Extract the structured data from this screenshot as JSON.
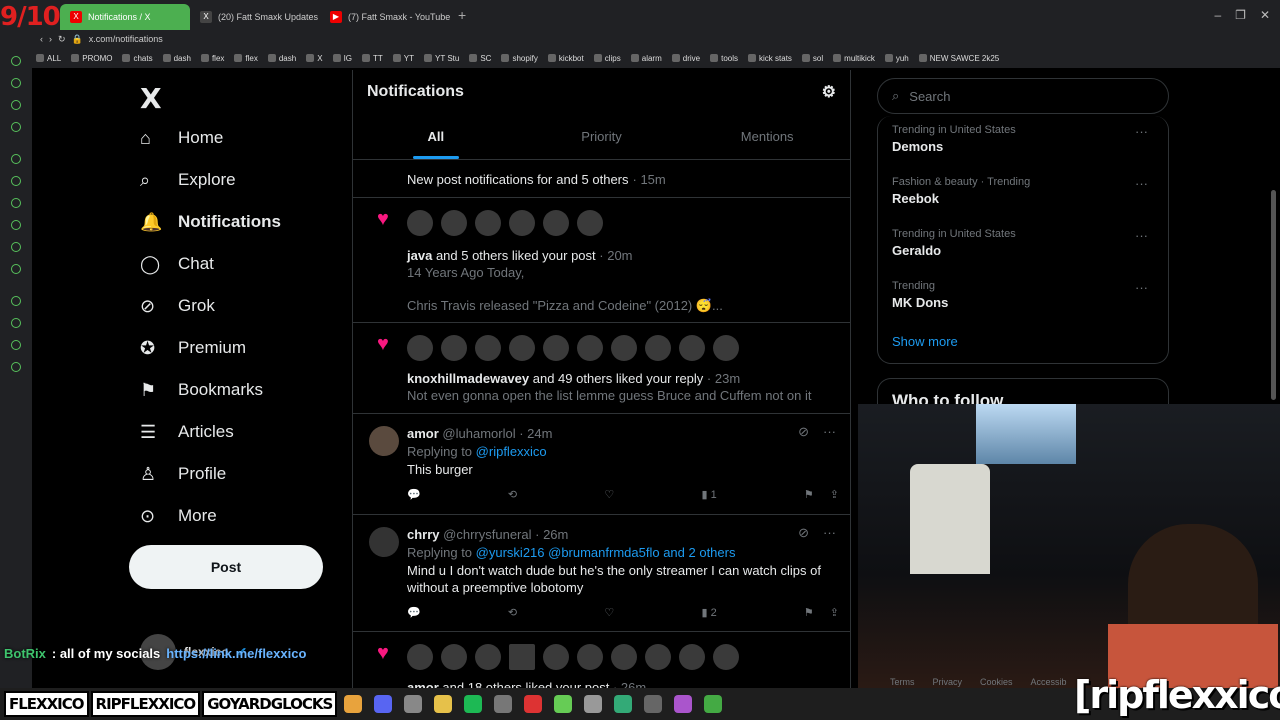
{
  "overlay": {
    "score": "9/10",
    "chat_bot": "BotRix",
    "chat_msg": ": all of my socials",
    "chat_link": "https://link.me/flexxico",
    "watermark": "[ripflexxico]"
  },
  "browser": {
    "tabs": [
      {
        "label": "Notifications / X",
        "active": true
      },
      {
        "label": "(20) Fatt Smaxk Updates (",
        "active": false
      },
      {
        "label": "(7) Fatt Smaxk - YouTube",
        "active": false
      }
    ],
    "url": "x.com/notifications",
    "bookmarks": [
      "ALL",
      "PROMO",
      "chats",
      "dash",
      "flex",
      "flex",
      "dash",
      "X",
      "IG",
      "TT",
      "YT",
      "YT Stu",
      "SC",
      "shopify",
      "kickbot",
      "clips",
      "alarm",
      "drive",
      "tools",
      "kick stats",
      "sol",
      "multikick",
      "yuh",
      "NEW SAWCE 2k25"
    ]
  },
  "nav": {
    "logo": "X",
    "items": [
      {
        "label": "Home",
        "icon": "home-icon"
      },
      {
        "label": "Explore",
        "icon": "search-icon"
      },
      {
        "label": "Notifications",
        "icon": "bell-icon"
      },
      {
        "label": "Chat",
        "icon": "chat-icon"
      },
      {
        "label": "Grok",
        "icon": "grok-icon"
      },
      {
        "label": "Premium",
        "icon": "premium-icon"
      },
      {
        "label": "Bookmarks",
        "icon": "bookmark-icon"
      },
      {
        "label": "Articles",
        "icon": "articles-icon"
      },
      {
        "label": "Profile",
        "icon": "profile-icon"
      },
      {
        "label": "More",
        "icon": "more-icon"
      }
    ],
    "post_label": "Post",
    "user_name": "flexxico"
  },
  "main": {
    "title": "Notifications",
    "tabs": [
      "All",
      "Priority",
      "Mentions"
    ],
    "n1": {
      "text": "New post notifications for",
      "suffix": "and 5 others",
      "time": "· 15m"
    },
    "n2": {
      "user": "java",
      "text": "and 5 others liked your post",
      "time": "· 20m",
      "line1": "14 Years Ago Today,",
      "line2": "Chris Travis released \"Pizza and Codeine\" (2012) 😴..."
    },
    "n3": {
      "user": "knoxhillmadewavey",
      "text": "and 49 others liked your reply",
      "time": "· 23m",
      "line1": "Not even gonna open the list lemme guess Bruce and Cuffem not on it"
    },
    "t1": {
      "name": "amor",
      "handle": "@luhamorlol",
      "time": "· 24m",
      "replying": "Replying to",
      "to": "@ripflexxico",
      "body": "This burger",
      "views": "1"
    },
    "t2": {
      "name": "chrry",
      "handle": "@chrrysfuneral",
      "time": "· 26m",
      "replying": "Replying to",
      "to": "@yurski216 @brumanfrmda5flo and 2 others",
      "body1": "Mind u I don't watch dude but he's the only streamer I can watch clips of",
      "body2": "without a preemptive lobotomy",
      "views": "2"
    },
    "n4": {
      "user": "amor",
      "text": "and 18 others liked your post",
      "time": "· 26m"
    }
  },
  "sidebar": {
    "search_placeholder": "Search",
    "trends": [
      {
        "meta": "Trending in United States",
        "name": "Demons"
      },
      {
        "meta": "Fashion & beauty · Trending",
        "name": "Reebok"
      },
      {
        "meta": "Trending in United States",
        "name": "Geraldo"
      },
      {
        "meta": "Trending",
        "name": "MK Dons"
      }
    ],
    "show_more": "Show more",
    "who_to_follow": "Who to follow",
    "footer": [
      "Terms",
      "Privacy",
      "Cookies",
      "Accessib"
    ]
  },
  "taskbar": {
    "stickers": [
      "FLEXXICO",
      "RIPFLEXXICO",
      "GOYARDGLOCKS"
    ]
  },
  "colors": {
    "accent": "#1d9bf0",
    "like": "#f91880",
    "bg": "#000000"
  }
}
